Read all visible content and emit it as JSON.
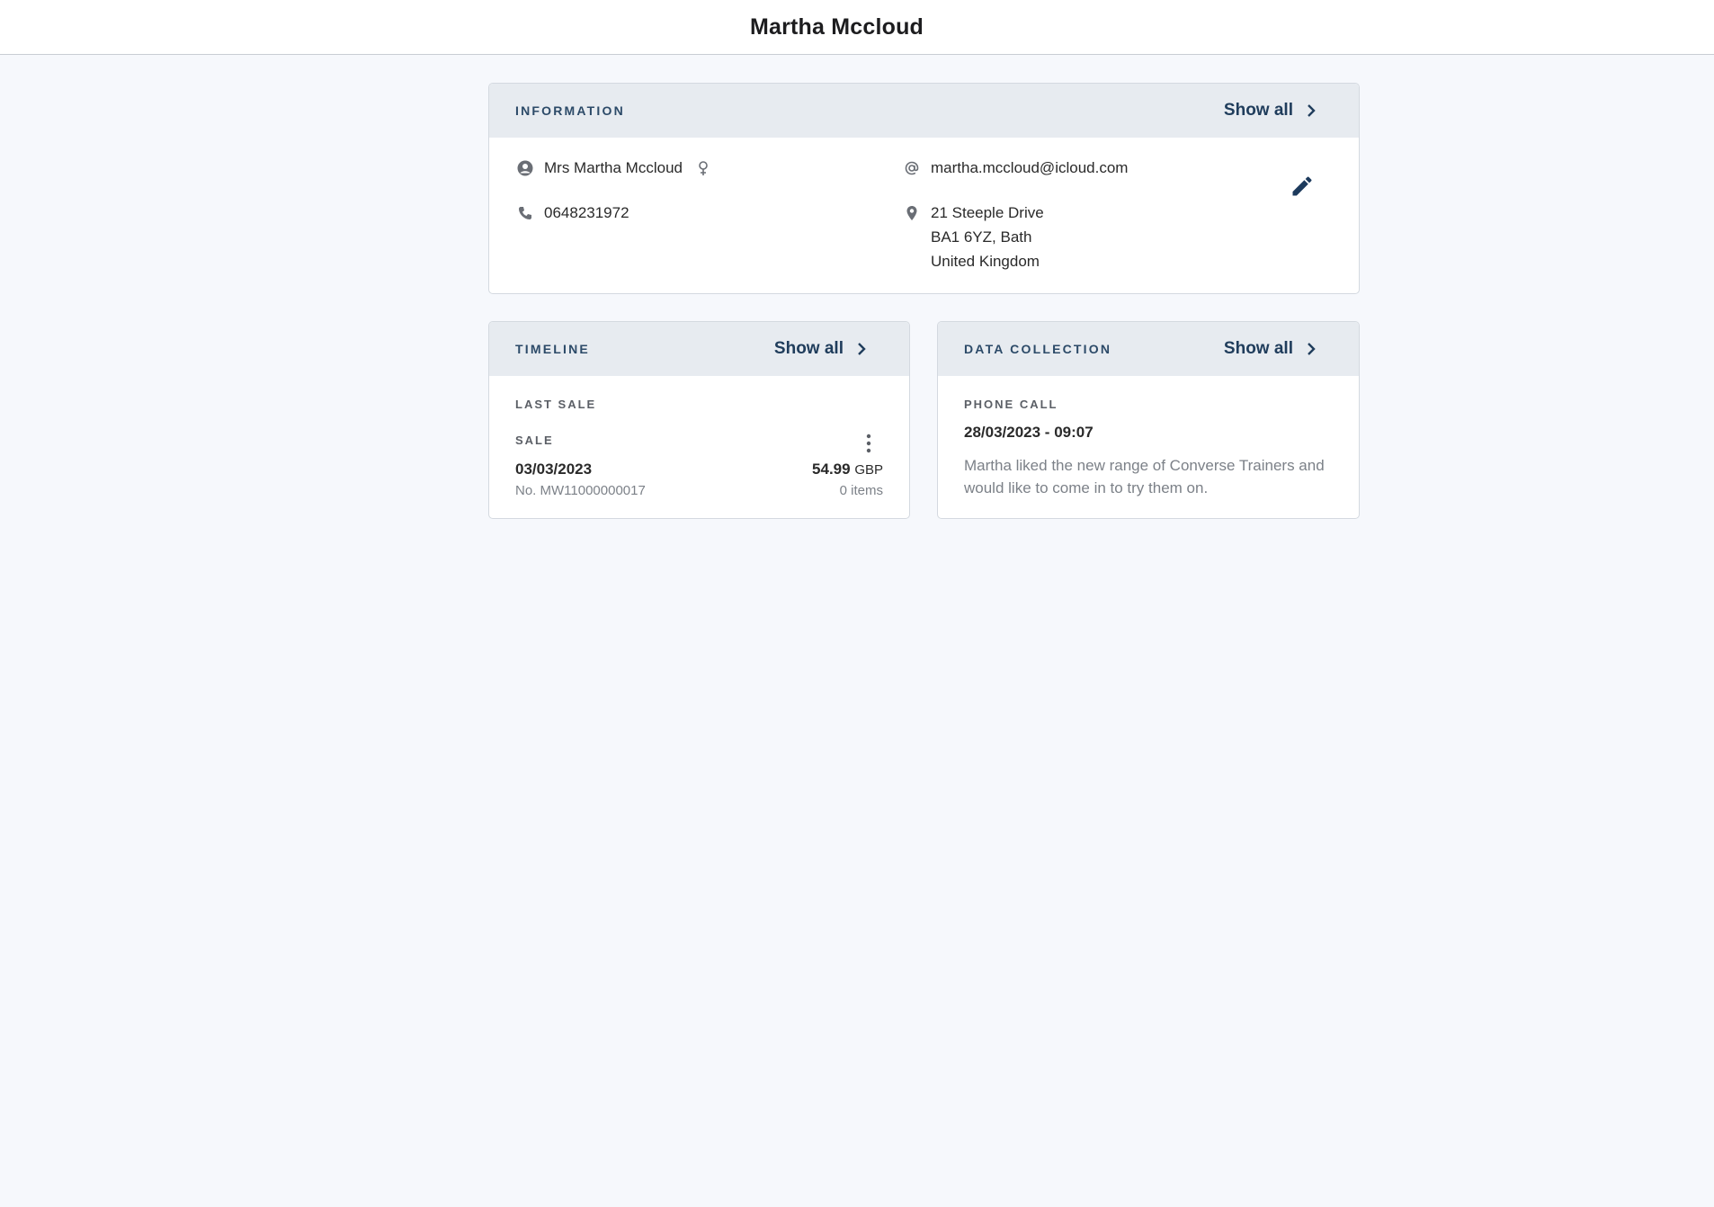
{
  "header": {
    "title": "Martha Mccloud"
  },
  "information": {
    "title": "INFORMATION",
    "show_all": "Show all",
    "name": "Mrs Martha Mccloud",
    "phone": "0648231972",
    "email": "martha.mccloud@icloud.com",
    "address_line1": "21 Steeple Drive",
    "address_line2": "BA1 6YZ, Bath",
    "address_line3": "United Kingdom"
  },
  "timeline": {
    "title": "TIMELINE",
    "show_all": "Show all",
    "section_label": "LAST SALE",
    "item_label": "SALE",
    "date": "03/03/2023",
    "number": "No. MW11000000017",
    "amount": "54.99",
    "currency": "GBP",
    "items": "0 items"
  },
  "data_collection": {
    "title": "DATA COLLECTION",
    "show_all": "Show all",
    "type_label": "PHONE CALL",
    "datetime": "28/03/2023 - 09:07",
    "note": "Martha liked the new range of Converse Trainers and would like to come in to try them on."
  },
  "colors": {
    "accent": "#203d5c",
    "header_bg": "#e7ebf0",
    "page_bg": "#f6f8fc"
  },
  "icons": [
    "user-circle-icon",
    "female-icon",
    "phone-icon",
    "at-icon",
    "location-pin-icon",
    "pencil-icon",
    "chevron-right-icon",
    "more-vertical-icon"
  ]
}
